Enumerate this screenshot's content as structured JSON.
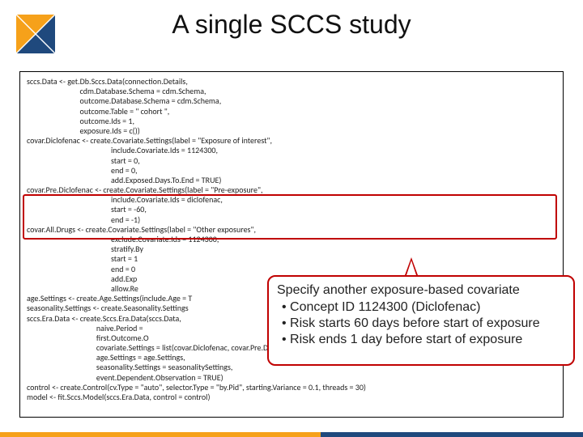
{
  "title": "A single SCCS study",
  "logo": {
    "colors": {
      "a": "#f6a11a",
      "b": "#1f497d"
    }
  },
  "code": "sccs.Data <- get.Db.Sccs.Data(connection.Details,\n                             cdm.Database.Schema = cdm.Schema,\n                             outcome.Database.Schema = cdm.Schema,\n                             outcome.Table = \" cohort \",\n                             outcome.Ids = 1,\n                             exposure.Ids = c())\ncovar.Diclofenac <- create.Covariate.Settings(label = \"Exposure of interest\",\n                                              include.Covariate.Ids = 1124300,\n                                              start = 0,\n                                              end = 0,\n                                              add.Exposed.Days.To.End = TRUE)\ncovar.Pre.Diclofenac <- create.Covariate.Settings(label = \"Pre-exposure\",\n                                              include.Covariate.Ids = diclofenac,\n                                              start = -60,\n                                              end = -1)\ncovar.All.Drugs <- create.Covariate.Settings(label = \"Other exposures\",\n                                              exclude.Covariate.Ids = 1124300,\n                                              stratify.By\n                                              start = 1\n                                              end = 0\n                                              add.Exp\n                                              allow.Re\nage.Settings <- create.Age.Settings(include.Age = T\nseasonality.Settings <- create.Seasonality.Settings\nsccs.Era.Data <- create.Sccs.Era.Data(sccs.Data,\n                                      naive.Period =\n                                      first.Outcome.O\n                                      covariate.Settings = list(covar.Diclofenac, covar.Pre.Diclofenac, covar.All.Drugs),\n                                      age.Settings = age.Settings,\n                                      seasonality.Settings = seasonalitySettings,\n                                      event.Dependent.Observation = TRUE)\ncontrol <- create.Control(cv.Type = \"auto\", selector.Type = \"by.Pid\", starting.Variance = 0.1, threads = 30)\nmodel <- fit.Sccs.Model(sccs.Era.Data, control = control)",
  "callout": {
    "lead": "Specify another exposure-based covariate",
    "bullets": [
      "Concept ID 1124300  (Diclofenac)",
      "Risk starts 60 days before start of exposure",
      "Risk ends 1 day before start of exposure"
    ]
  }
}
